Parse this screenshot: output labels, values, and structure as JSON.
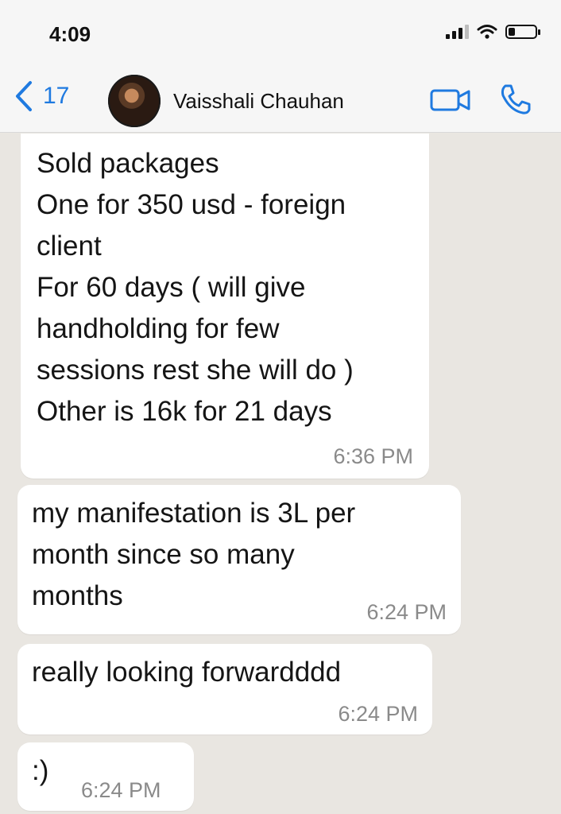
{
  "status_bar": {
    "time": "4:09"
  },
  "header": {
    "back_count": "17",
    "contact_name": "Vaisshali Chauhan"
  },
  "messages": [
    {
      "text": "Sold packages\nOne for 350 usd - foreign\nclient\nFor 60 days ( will give\nhandholding for few\nsessions rest she will do )\nOther is 16k for 21 days",
      "time": "6:36 PM"
    },
    {
      "text": "my manifestation is 3L per\nmonth since so many\nmonths",
      "time": "6:24 PM"
    },
    {
      "text": "really looking forwardddd",
      "time": "6:24 PM"
    },
    {
      "text": ":)",
      "time": "6:24 PM"
    }
  ],
  "colors": {
    "accent": "#1f7ae0",
    "chat_bg": "#e9e6e1",
    "bubble": "#ffffff"
  }
}
